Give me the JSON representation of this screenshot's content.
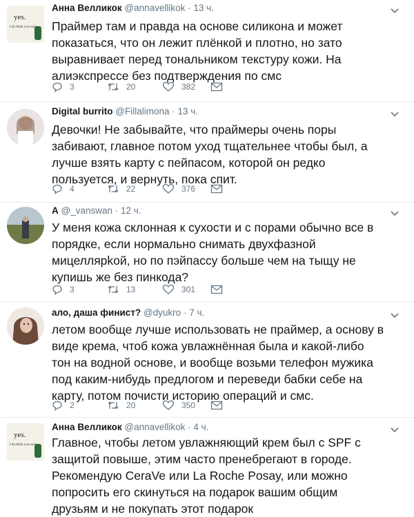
{
  "tweets": [
    {
      "name": "Анна Велликок",
      "handle": "@annavellikok",
      "time": "· 13 ч.",
      "avatar": "yes-card-avatar",
      "lines": [
        "Праймер там и правда на основе силикона и может",
        "показаться, что он лежит плёнкой и плотно, но зато",
        "выравнивает перед тональником текстуру кожи. На",
        "алиэкспрессе без подтверждения по смс"
      ],
      "replies": "3",
      "retweets": "20",
      "likes": "382"
    },
    {
      "name": "Digital burrito",
      "handle": "@Fillalimona",
      "time": "· 13 ч.",
      "avatar": "girl-photo-avatar",
      "lines": [
        "Девочки! Не забывайте, что праймеры очень поры",
        "забивают, главное потом уход тщательнее чтобы был, а",
        "лучше взять карту с пейпасом, которой он редко",
        "пользуется, и вернуть, пока спит."
      ],
      "replies": "4",
      "retweets": "22",
      "likes": "376"
    },
    {
      "name": "А",
      "handle": "@_vanswan",
      "time": "· 12 ч.",
      "avatar": "landscape-photo-avatar",
      "lines": [
        "У меня кожа склонная к сухости и с порами обычно все в",
        "порядке, если нормально снимать двухфазной",
        "мицеллярkой, но по пэйпассу больше чем на тыщу не",
        "купишь же без пинкода?"
      ],
      "replies": "3",
      "retweets": "13",
      "likes": "301"
    },
    {
      "name": "ало, даша финист?",
      "handle": "@dyukro",
      "time": "· 7 ч.",
      "avatar": "portrait-photo-avatar",
      "lines": [
        "летом вообще лучше использовать не праймер, а основу в",
        "виде крема, чтоб кожа увлажнённая была и какой-либо",
        "тон на водной основе, и вообще возьми телефон мужика",
        "под каким-нибудь предлогом и переведи бабки себе на",
        "карту, потом почисти историю операций и смс."
      ],
      "replies": "2",
      "retweets": "20",
      "likes": "350"
    },
    {
      "name": "Анна Велликок",
      "handle": "@annavellikok",
      "time": "· 4 ч.",
      "avatar": "yes-card-avatar",
      "lines": [
        "Главное, чтобы летом увлажняющий крем был с SPF с",
        "защитой повыше, этим часто пренебрегают в городе.",
        "Рекомендую CeraVe или La Roche Posay, или можно",
        "попросить его скинуться на подарок вашим общим",
        "друзьям и не покупать этот подарок"
      ]
    }
  ],
  "avatar_text": {
    "yes": "yes.",
    "small": "I do think you suck"
  },
  "colors": {
    "text": "#14171a",
    "secondary": "#657786",
    "divider": "#e6ecf0"
  }
}
